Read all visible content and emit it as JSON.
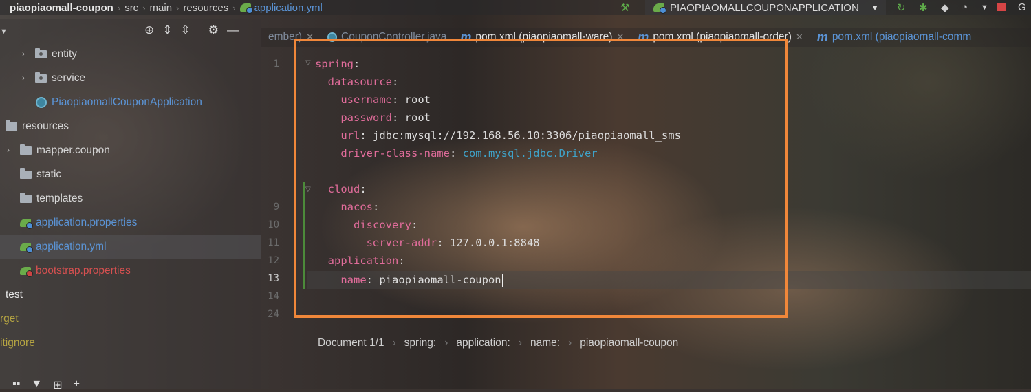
{
  "breadcrumb": {
    "project": "piaopiaomall-coupon",
    "parts": [
      "src",
      "main",
      "resources"
    ],
    "file": "application.yml"
  },
  "run_config": {
    "name": "PIAOPIAOMALLCOUPONAPPLICATION",
    "extra": "G"
  },
  "tree": {
    "items": [
      {
        "label": "entity",
        "kind": "package",
        "color": "#d6d6d6"
      },
      {
        "label": "service",
        "kind": "package",
        "color": "#d6d6d6"
      },
      {
        "label": "PiaopiaomallCouponApplication",
        "kind": "class",
        "color": "#5b94d6"
      },
      {
        "label": "resources",
        "kind": "folder",
        "color": "#d6d6d6"
      },
      {
        "label": "mapper.coupon",
        "kind": "folder",
        "color": "#d6d6d6"
      },
      {
        "label": "static",
        "kind": "folder",
        "color": "#d6d6d6"
      },
      {
        "label": "templates",
        "kind": "folder",
        "color": "#d6d6d6"
      },
      {
        "label": "application.properties",
        "kind": "leaf",
        "color": "#5b94d6"
      },
      {
        "label": "application.yml",
        "kind": "leaf",
        "color": "#5b94d6"
      },
      {
        "label": "bootstrap.properties",
        "kind": "leaf",
        "color": "#d65050"
      },
      {
        "label": "test",
        "kind": "folder",
        "color": "#e8e8e8"
      },
      {
        "label": "rget",
        "kind": "folder",
        "color": "#b5a442"
      },
      {
        "label": "itignore",
        "kind": "file",
        "color": "#b5a442"
      }
    ]
  },
  "tabs": [
    {
      "label": "ember)",
      "dim": true
    },
    {
      "label": "CouponController.java",
      "dim": true
    },
    {
      "label": "pom.xml (piaopiaomall-ware)",
      "dim": false
    },
    {
      "label": "pom.xml (piaopiaomall-order)",
      "dim": false
    },
    {
      "label": "pom.xml (piaopiaomall-comm",
      "dim": false
    }
  ],
  "line_numbers": [
    "1",
    "",
    "",
    "",
    "",
    "",
    "",
    "",
    "9",
    "10",
    "11",
    "12",
    "13",
    "14",
    "24"
  ],
  "code": {
    "l1_key": "spring",
    "l2_key": "datasource",
    "l3_key": "username",
    "l3_val": "root",
    "l4_key": "password",
    "l4_val": "root",
    "l5_key": "url",
    "l5_val": "jdbc:mysql://192.168.56.10:3306/piaopiaomall_sms",
    "l6_key": "driver-class-name",
    "l6_val": "com.mysql.jdbc.Driver",
    "l8_key": "cloud",
    "l9_key": "nacos",
    "l10_key": "discovery",
    "l11_key": "server-addr",
    "l11_val": "127.0.0.1:8848",
    "l12_key": "application",
    "l13_key": "name",
    "l13_val": "piaopiaomall-coupon"
  },
  "status_path": [
    "Document 1/1",
    "spring:",
    "application:",
    "name:",
    "piaopiaomall-coupon"
  ],
  "colors": {
    "highlight_box": "#f0873a",
    "yaml_key": "#e06c9a",
    "link": "#5b94d6"
  }
}
